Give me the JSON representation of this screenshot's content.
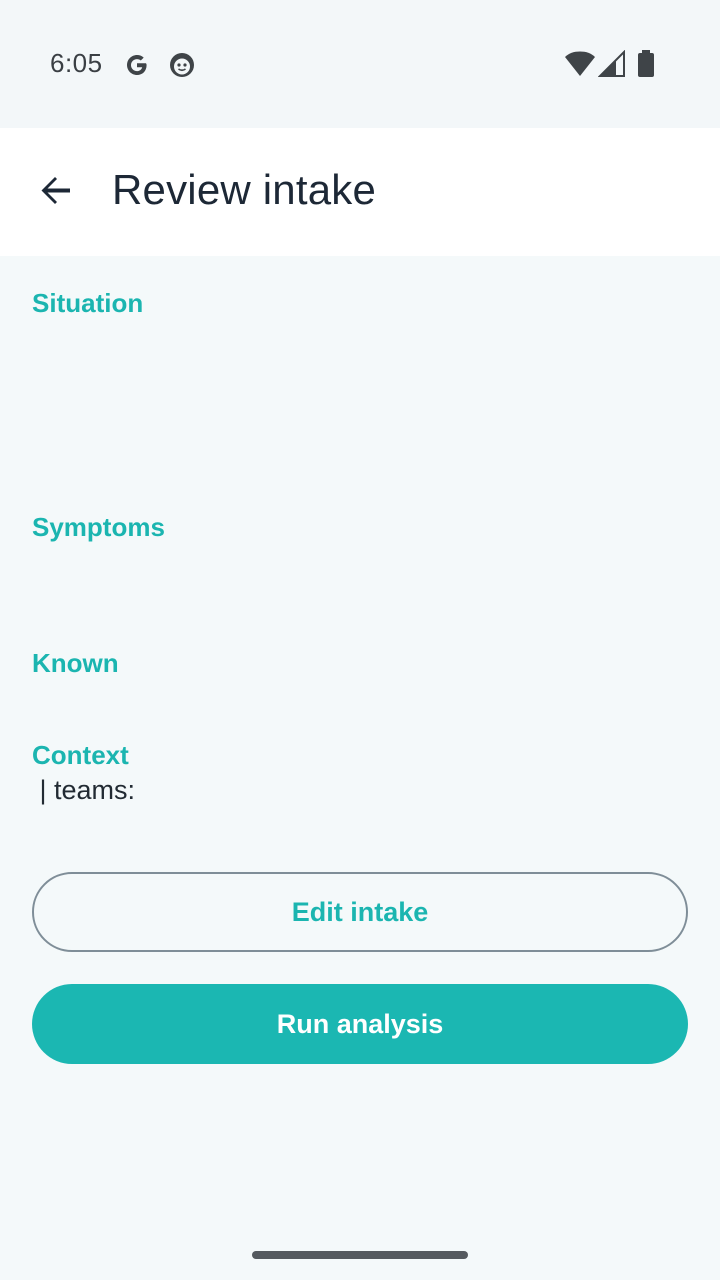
{
  "status_bar": {
    "time": "6:05",
    "icons": [
      "google-icon",
      "face-icon",
      "wifi-icon",
      "cellular-signal-icon",
      "battery-icon"
    ]
  },
  "app_bar": {
    "back_icon": "arrow-back-icon",
    "title": "Review intake"
  },
  "sections": {
    "situation": {
      "label": "Situation",
      "value": ""
    },
    "symptoms": {
      "label": "Symptoms",
      "value": ""
    },
    "known": {
      "label": "Known",
      "value": ""
    },
    "context": {
      "label": "Context",
      "value": " | teams: "
    }
  },
  "actions": {
    "edit_label": "Edit intake",
    "run_label": "Run analysis"
  },
  "colors": {
    "accent": "#1bb7b2",
    "title": "#1d2836",
    "background": "#f4f9fa",
    "outline": "#7f8e98"
  }
}
